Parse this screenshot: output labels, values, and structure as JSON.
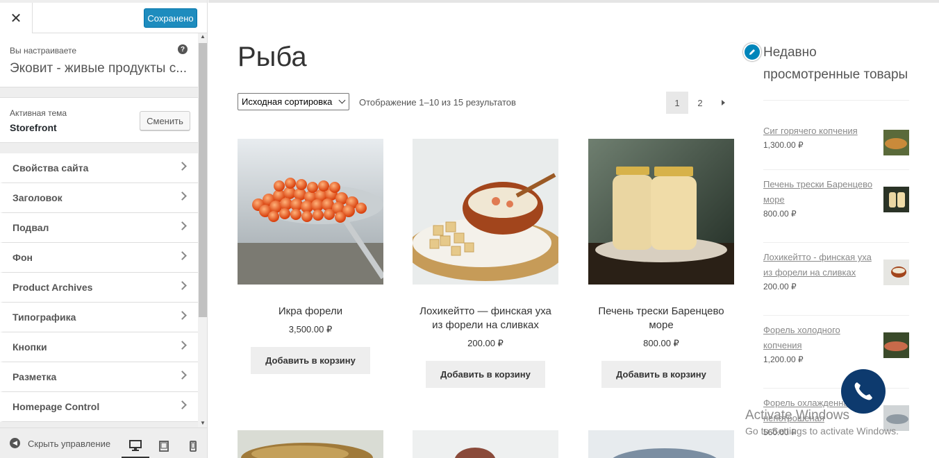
{
  "sidebar": {
    "close_icon": "close-icon",
    "saved_label": "Сохранено",
    "customizing_label": "Вы настраиваете",
    "site_title": "Эковит - живые продукты с...",
    "help_icon": "?",
    "active_theme_label": "Активная тема",
    "active_theme_name": "Storefront",
    "change_theme_label": "Сменить",
    "menu_items": [
      {
        "label": "Свойства сайта"
      },
      {
        "label": "Заголовок"
      },
      {
        "label": "Подвал"
      },
      {
        "label": "Фон"
      },
      {
        "label": "Product Archives"
      },
      {
        "label": "Типографика"
      },
      {
        "label": "Кнопки"
      },
      {
        "label": "Разметка"
      },
      {
        "label": "Homepage Control"
      }
    ],
    "collapse_label": "Скрыть управление",
    "devices": [
      "desktop-icon",
      "tablet-icon",
      "mobile-icon"
    ]
  },
  "preview": {
    "page_title": "Рыба",
    "sort_value": "Исходная сортировка",
    "result_count": "Отображение 1–10 из 15 результатов",
    "pages": [
      "1",
      "2"
    ],
    "products": [
      {
        "title": "Икра форели",
        "price": "3,500.00 ₽",
        "button": "Добавить в корзину"
      },
      {
        "title": "Лохикейтто — финская уха из форели на сливках",
        "price": "200.00 ₽",
        "button": "Добавить в корзину"
      },
      {
        "title": "Печень трески Баренцево море",
        "price": "800.00 ₽",
        "button": "Добавить в корзину"
      }
    ],
    "widget": {
      "title": "Недавно просмотренные товары",
      "items": [
        {
          "name": "Сиг горячего копчения",
          "price": "1,300.00 ₽"
        },
        {
          "name": "Печень трески Баренцево море",
          "price": "800.00 ₽"
        },
        {
          "name": "Лохикейтто - финская уха из форели на сливках",
          "price": "200.00 ₽"
        },
        {
          "name": "Форель холодного копчения",
          "price": "1,200.00 ₽"
        },
        {
          "name": "Форель охлажденная непотрошеная",
          "price": "560.00 ₽"
        }
      ]
    },
    "watermark_title": "Activate Windows",
    "watermark_sub": "Go to Settings to activate Windows.",
    "colors": {
      "accent": "#0085ba",
      "saved_button": "#1e8cbe",
      "call_button": "#0d3a6e"
    }
  }
}
